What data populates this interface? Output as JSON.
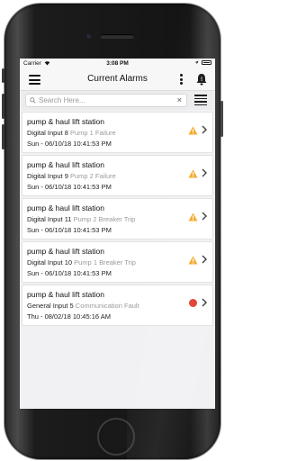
{
  "status_bar": {
    "carrier": "Carrier",
    "time": "3:08 PM"
  },
  "nav": {
    "title": "Current Alarms"
  },
  "search": {
    "placeholder": "Search Here...",
    "clear": "×"
  },
  "alarms": [
    {
      "site": "pump & haul lift station",
      "input": "Digital Input 8",
      "description": "Pump 1 Failure",
      "timestamp": "Sun - 06/10/18 10:41:53 PM",
      "severity_icon": "warning-triangle-icon",
      "severity_color": "#f5a623"
    },
    {
      "site": "pump & haul lift station",
      "input": "Digital Input 9",
      "description": "Pump 2 Failure",
      "timestamp": "Sun - 06/10/18 10:41:53 PM",
      "severity_icon": "warning-triangle-icon",
      "severity_color": "#f5a623"
    },
    {
      "site": "pump & haul lift station",
      "input": "Digital Input 11",
      "description": "Pump 2 Breaker Trip",
      "timestamp": "Sun - 06/10/18 10:41:53 PM",
      "severity_icon": "warning-triangle-icon",
      "severity_color": "#f5a623"
    },
    {
      "site": "pump & haul lift station",
      "input": "Digital Input 10",
      "description": "Pump 1 Breaker Trip",
      "timestamp": "Sun - 06/10/18 10:41:53 PM",
      "severity_icon": "warning-triangle-icon",
      "severity_color": "#f5a623"
    },
    {
      "site": "pump & haul lift station",
      "input": "General Input 5",
      "description": "Communication Fault",
      "timestamp": "Thu - 08/02/18 10:45:16 AM",
      "severity_icon": "red-dot-icon",
      "severity_color": "#e03a2b"
    }
  ]
}
